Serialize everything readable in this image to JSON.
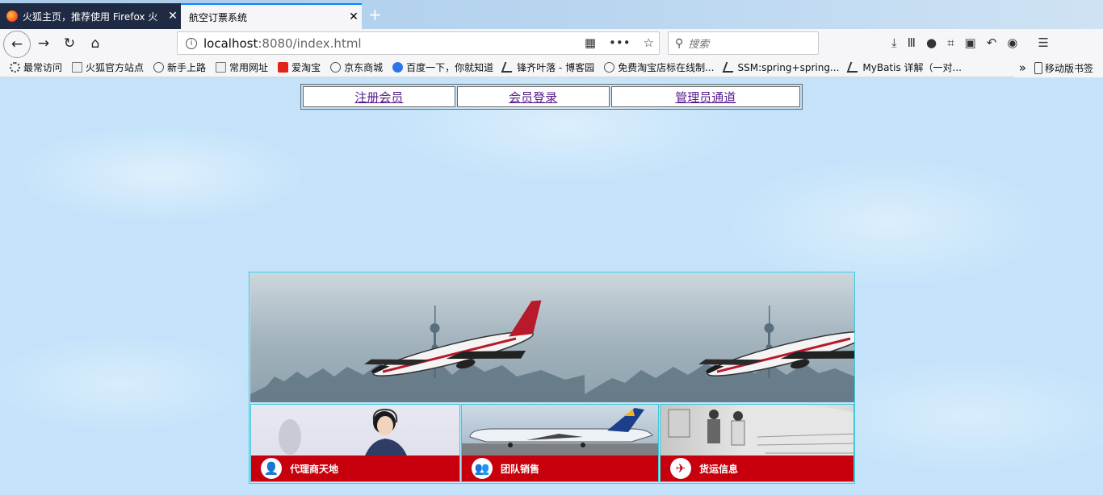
{
  "browser": {
    "tabs": [
      {
        "title": "火狐主页，推荐使用 Firefox 火",
        "close": "✕"
      },
      {
        "title": "航空订票系统",
        "close": "✕"
      }
    ],
    "new_tab": "+",
    "url_host": "localhost",
    "url_rest": ":8080/index.html",
    "search_placeholder": "搜索",
    "bookmarks": [
      {
        "label": "最常访问",
        "icon": "gear-icon"
      },
      {
        "label": "火狐官方站点",
        "icon": "folder-icon"
      },
      {
        "label": "新手上路",
        "icon": "globe-icon"
      },
      {
        "label": "常用网址",
        "icon": "folder-icon"
      },
      {
        "label": "爱淘宝",
        "icon": "taobao-icon"
      },
      {
        "label": "京东商城",
        "icon": "globe-icon"
      },
      {
        "label": "百度一下，你就知道",
        "icon": "baidu-paw-icon"
      },
      {
        "label": "锋齐叶落 - 博客园",
        "icon": "leaf-icon"
      },
      {
        "label": "免费淘宝店标在线制...",
        "icon": "globe-icon"
      },
      {
        "label": "SSM:spring+spring...",
        "icon": "leaf-icon"
      },
      {
        "label": "MyBatis 详解（一对...",
        "icon": "leaf-icon"
      }
    ],
    "bookmarks_more": "»",
    "mobile_bookmarks": "移动版书签"
  },
  "page": {
    "nav": {
      "register": "注册会员",
      "login": "会员登录",
      "admin": "管理员通道"
    },
    "tiles": [
      {
        "label": "代理商天地",
        "icon": "person-icon"
      },
      {
        "label": "团队销售",
        "icon": "group-icon"
      },
      {
        "label": "货运信息",
        "icon": "plane-icon"
      }
    ]
  },
  "colors": {
    "page_background": "#c4e3fa",
    "tile_bar_red": "#c8000d",
    "grid_border": "#3cc8d8",
    "link_visited": "#551a8b"
  }
}
